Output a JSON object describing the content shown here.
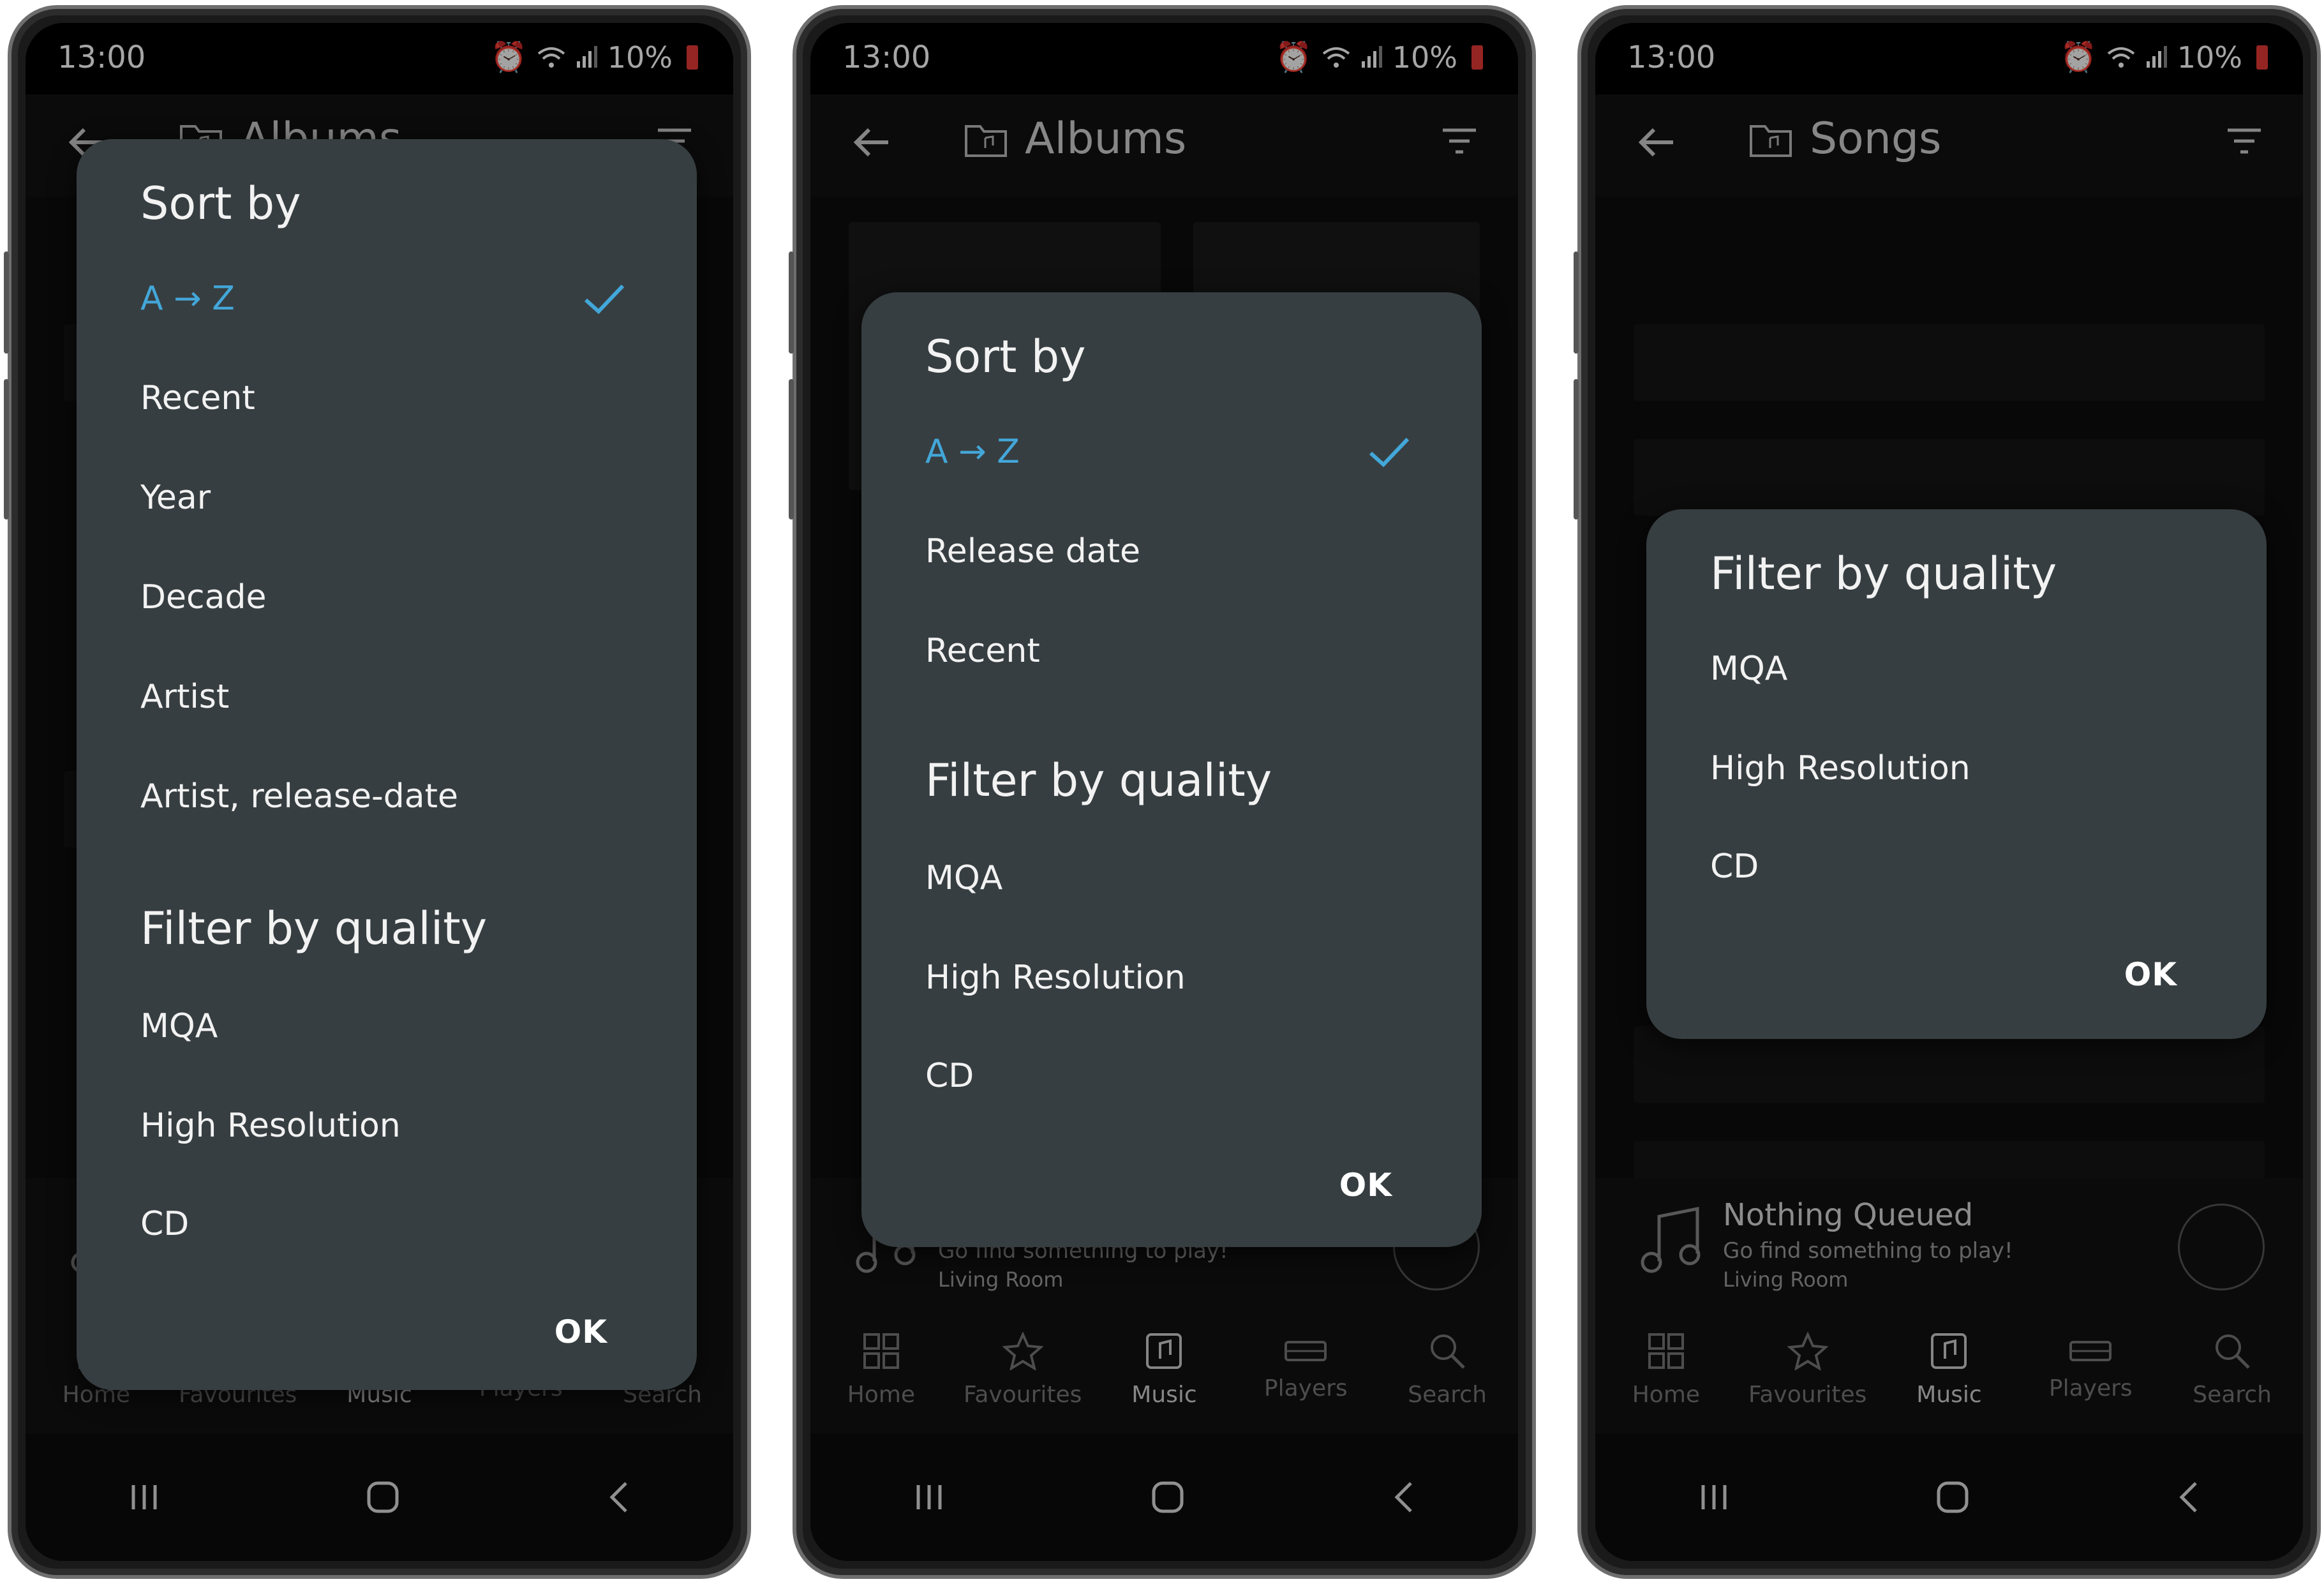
{
  "status": {
    "time": "13:00",
    "battery": "10%"
  },
  "colors": {
    "accent": "#43a7d9",
    "dialog_bg": "#373e41",
    "battery": "#e53935"
  },
  "icons": [
    "back-arrow-icon",
    "folder-music-icon",
    "filter-icon",
    "check-icon",
    "music-note-icon",
    "volume-icon",
    "home-icon",
    "star-icon",
    "music-icon",
    "players-icon",
    "search-icon",
    "recents-icon",
    "home-button-icon",
    "back-nav-icon",
    "alarm-icon",
    "wifi-icon",
    "signal-icon",
    "battery-icon"
  ],
  "tabs": [
    {
      "label": "Home"
    },
    {
      "label": "Favourites"
    },
    {
      "label": "Music"
    },
    {
      "label": "Players"
    },
    {
      "label": "Search"
    }
  ],
  "mini_player": {
    "title": "Nothing Queued",
    "subtitle": "Go find something to play!",
    "device": "Living Room"
  },
  "phones": [
    {
      "title": "Albums",
      "sort_heading": "Sort by",
      "sort_items": [
        "A → Z",
        "Recent",
        "Year",
        "Decade",
        "Artist",
        "Artist, release-date"
      ],
      "filter_heading": "Filter by quality",
      "filter_items": [
        "MQA",
        "High Resolution",
        "CD"
      ],
      "ok": "OK"
    },
    {
      "title": "Albums",
      "sort_heading": "Sort by",
      "sort_items": [
        "A → Z",
        "Release date",
        "Recent"
      ],
      "filter_heading": "Filter by quality",
      "filter_items": [
        "MQA",
        "High Resolution",
        "CD"
      ],
      "ok": "OK"
    },
    {
      "title": "Songs",
      "filter_heading": "Filter by quality",
      "filter_items": [
        "MQA",
        "High Resolution",
        "CD"
      ],
      "ok": "OK"
    }
  ]
}
